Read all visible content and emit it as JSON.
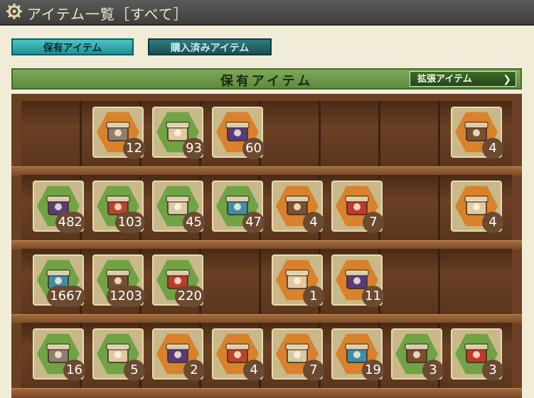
{
  "title": "アイテム一覧［すべて］",
  "tabs": {
    "owned": "保有アイテム",
    "purchased": "購入済みアイテム"
  },
  "header": {
    "title": "保有アイテム",
    "expand_button": "拡張アイテム"
  },
  "colors": {
    "hex_orange": "#d9822b",
    "hex_green": "#6fa344",
    "count_badge": "#6b4a32"
  },
  "shelf": {
    "rows": [
      [
        null,
        {
          "name": "repair-kit-box-icon",
          "hex": "orange",
          "count": "12"
        },
        {
          "name": "screw-icon",
          "hex": "green",
          "count": "93"
        },
        {
          "name": "fairy-cook-icon",
          "hex": "orange",
          "count": "60"
        },
        null,
        null,
        null,
        {
          "name": "blueprint-fairy-icon",
          "hex": "orange",
          "count": "4"
        }
      ],
      [
        {
          "name": "present-box-brown-icon",
          "hex": "green",
          "count": "482"
        },
        {
          "name": "present-box-purple-icon",
          "hex": "green",
          "count": "103"
        },
        {
          "name": "present-box-red-icon",
          "hex": "green",
          "count": "45"
        },
        {
          "name": "trophy-cup-icon",
          "hex": "green",
          "count": "47"
        },
        {
          "name": "wood-planks-icon",
          "hex": "orange",
          "count": "4"
        },
        {
          "name": "fairy-headband-icon",
          "hex": "orange",
          "count": "7"
        },
        null,
        {
          "name": "fairy-wrench-icon",
          "hex": "orange",
          "count": "4"
        }
      ],
      [
        {
          "name": "bucket-icon",
          "hex": "green",
          "count": "1667"
        },
        {
          "name": "burner-icon",
          "hex": "green",
          "count": "1203"
        },
        {
          "name": "development-material-icon",
          "hex": "green",
          "count": "220"
        },
        null,
        {
          "name": "fairy-helmet-icon",
          "hex": "orange",
          "count": "1"
        },
        {
          "name": "fairy-mechanic-icon",
          "hex": "orange",
          "count": "11"
        },
        null,
        null
      ],
      [
        {
          "name": "pilot-fairy-icon",
          "hex": "green",
          "count": "16"
        },
        {
          "name": "two-fairies-icon",
          "hex": "green",
          "count": "5"
        },
        {
          "name": "armor-plate-icon",
          "hex": "orange",
          "count": "2"
        },
        {
          "name": "canteen-icon",
          "hex": "orange",
          "count": "4"
        },
        {
          "name": "rice-ball-icon",
          "hex": "orange",
          "count": "7"
        },
        {
          "name": "supply-crate-icon",
          "hex": "orange",
          "count": "19"
        },
        {
          "name": "armored-vehicle-icon",
          "hex": "green",
          "count": "3"
        },
        {
          "name": "tools-set-icon",
          "hex": "green",
          "count": "3"
        }
      ]
    ]
  }
}
